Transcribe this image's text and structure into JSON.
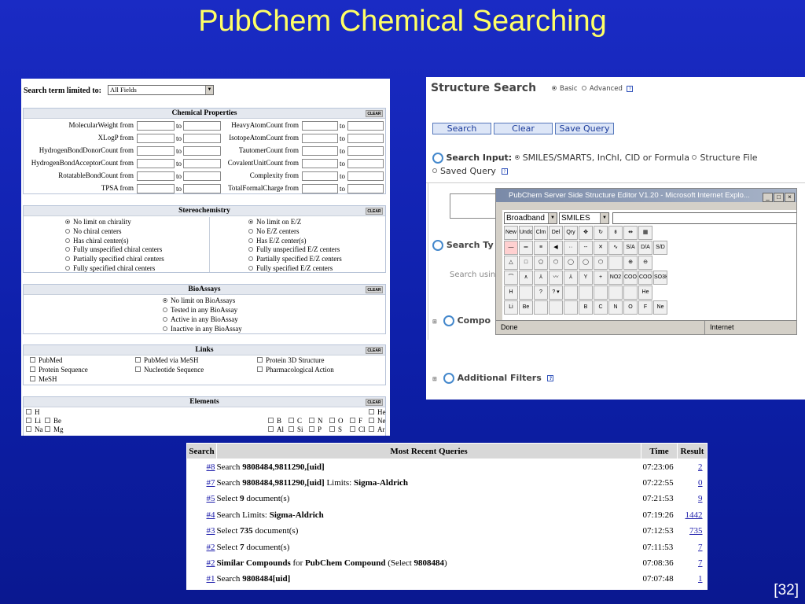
{
  "slide": {
    "title": "PubChem Chemical Searching",
    "number": "[32]"
  },
  "form": {
    "search_term_label": "Search term limited to:",
    "search_term_value": "All Fields",
    "clear_label": "CLEAR",
    "chemical_properties": {
      "title": "Chemical Properties",
      "to_label": "to",
      "left_rows": [
        "MolecularWeight from",
        "XLogP from",
        "HydrogenBondDonorCount from",
        "HydrogenBondAcceptorCount from",
        "RotatableBondCount from",
        "TPSA from"
      ],
      "right_rows": [
        "HeavyAtomCount from",
        "IsotopeAtomCount from",
        "TautomerCount from",
        "CovalentUnitCount from",
        "Complexity from",
        "TotalFormalCharge from"
      ]
    },
    "stereochemistry": {
      "title": "Stereochemistry",
      "left": [
        "No limit on chirality",
        "No chiral centers",
        "Has chiral center(s)",
        "Fully unspecified chiral centers",
        "Partially specified chiral centers",
        "Fully specified chiral centers"
      ],
      "right": [
        "No limit on E/Z",
        "No E/Z centers",
        "Has E/Z center(s)",
        "Fully unspecified E/Z centers",
        "Partially specified E/Z centers",
        "Fully specified E/Z centers"
      ]
    },
    "bioassays": {
      "title": "BioAssays",
      "options": [
        "No limit on BioAssays",
        "Tested in any BioAssay",
        "Active in any BioAssay",
        "Inactive in any BioAssay"
      ]
    },
    "links": {
      "title": "Links",
      "col1": [
        "PubMed",
        "Protein Sequence",
        "MeSH"
      ],
      "col2": [
        "PubMed via MeSH",
        "Nucleotide Sequence"
      ],
      "col3": [
        "Protein 3D Structure",
        "Pharmacological Action"
      ]
    },
    "elements": {
      "title": "Elements",
      "row1_left": [
        "H"
      ],
      "row1_right": [
        "He"
      ],
      "row2_left": [
        "Li",
        "Be"
      ],
      "row2_mid": [
        "B",
        "C",
        "N",
        "O",
        "F"
      ],
      "row2_right": [
        "Ne"
      ],
      "row3_left": [
        "Na",
        "Mg"
      ],
      "row3_mid": [
        "Al",
        "Si",
        "P",
        "S",
        "Cl"
      ],
      "row3_right": [
        "Ar"
      ]
    }
  },
  "structure_search": {
    "title": "Structure Search",
    "mode_basic": "Basic",
    "mode_advanced": "Advanced",
    "help": "?",
    "buttons": [
      "Search",
      "Clear",
      "Save Query"
    ],
    "input_label": "Search Input:",
    "input_opt1": "SMILES/SMARTS, InChI, CID or Formula",
    "input_opt2": "Structure File",
    "saved_query": "Saved Query",
    "search_type_label": "Search Ty",
    "search_using": "Search usin",
    "compound_label": "Compo",
    "additional_filters": "Additional Filters"
  },
  "editor": {
    "title": "PubChem Server Side Structure Editor V1.20 - Microsoft Internet Explo...",
    "format_select": "Broadband",
    "type_select": "SMILES",
    "tool_rows": [
      [
        "New",
        "Undo",
        "Clm",
        "Del",
        "Qry",
        "✥",
        "↻",
        "⇟",
        "⇹",
        "▦"
      ],
      [
        "—",
        "═",
        "≡",
        "◀",
        "··",
        "--",
        "✕",
        "∿",
        "S/A",
        "D/A",
        "S/D"
      ],
      [
        "△",
        "□",
        "⬠",
        "⬡",
        "◯",
        "◯",
        "⬡",
        "",
        "⊕",
        "⊖"
      ],
      [
        "⌒",
        "∧",
        "⅄",
        "〰",
        "⅄",
        "Y",
        "+",
        "NO2",
        "COOH",
        "COOMe",
        "SO3H"
      ],
      [
        "H",
        "",
        "?",
        "? ▾",
        "",
        "",
        "",
        "",
        "",
        "He"
      ],
      [
        "Li",
        "Be",
        "",
        "",
        "",
        "B",
        "C",
        "N",
        "O",
        "F",
        "Ne"
      ]
    ],
    "status_done": "Done",
    "status_zone": "Internet"
  },
  "queries": {
    "headers": [
      "Search",
      "Most Recent Queries",
      "Time",
      "Result"
    ],
    "rows": [
      {
        "num": "#8",
        "query": "Search 9808484,9811290,[uid]",
        "time": "07:23:06",
        "result": "2"
      },
      {
        "num": "#7",
        "query": "Search 9808484,9811290,[uid] Limits: Sigma-Aldrich",
        "time": "07:22:55",
        "result": "0"
      },
      {
        "num": "#5",
        "query": "Select 9 document(s)",
        "time": "07:21:53",
        "result": "9"
      },
      {
        "num": "#4",
        "query": "Search Limits: Sigma-Aldrich",
        "time": "07:19:26",
        "result": "1442"
      },
      {
        "num": "#3",
        "query": "Select 735 document(s)",
        "time": "07:12:53",
        "result": "735"
      },
      {
        "num": "#2",
        "query": "Select 7 document(s)",
        "time": "07:11:53",
        "result": "7"
      },
      {
        "num": "#2",
        "query": "Similar Compounds for PubChem Compound (Select 9808484)",
        "time": "07:08:36",
        "result": "7"
      },
      {
        "num": "#1",
        "query": "Search 9808484[uid]",
        "time": "07:07:48",
        "result": "1"
      }
    ]
  }
}
